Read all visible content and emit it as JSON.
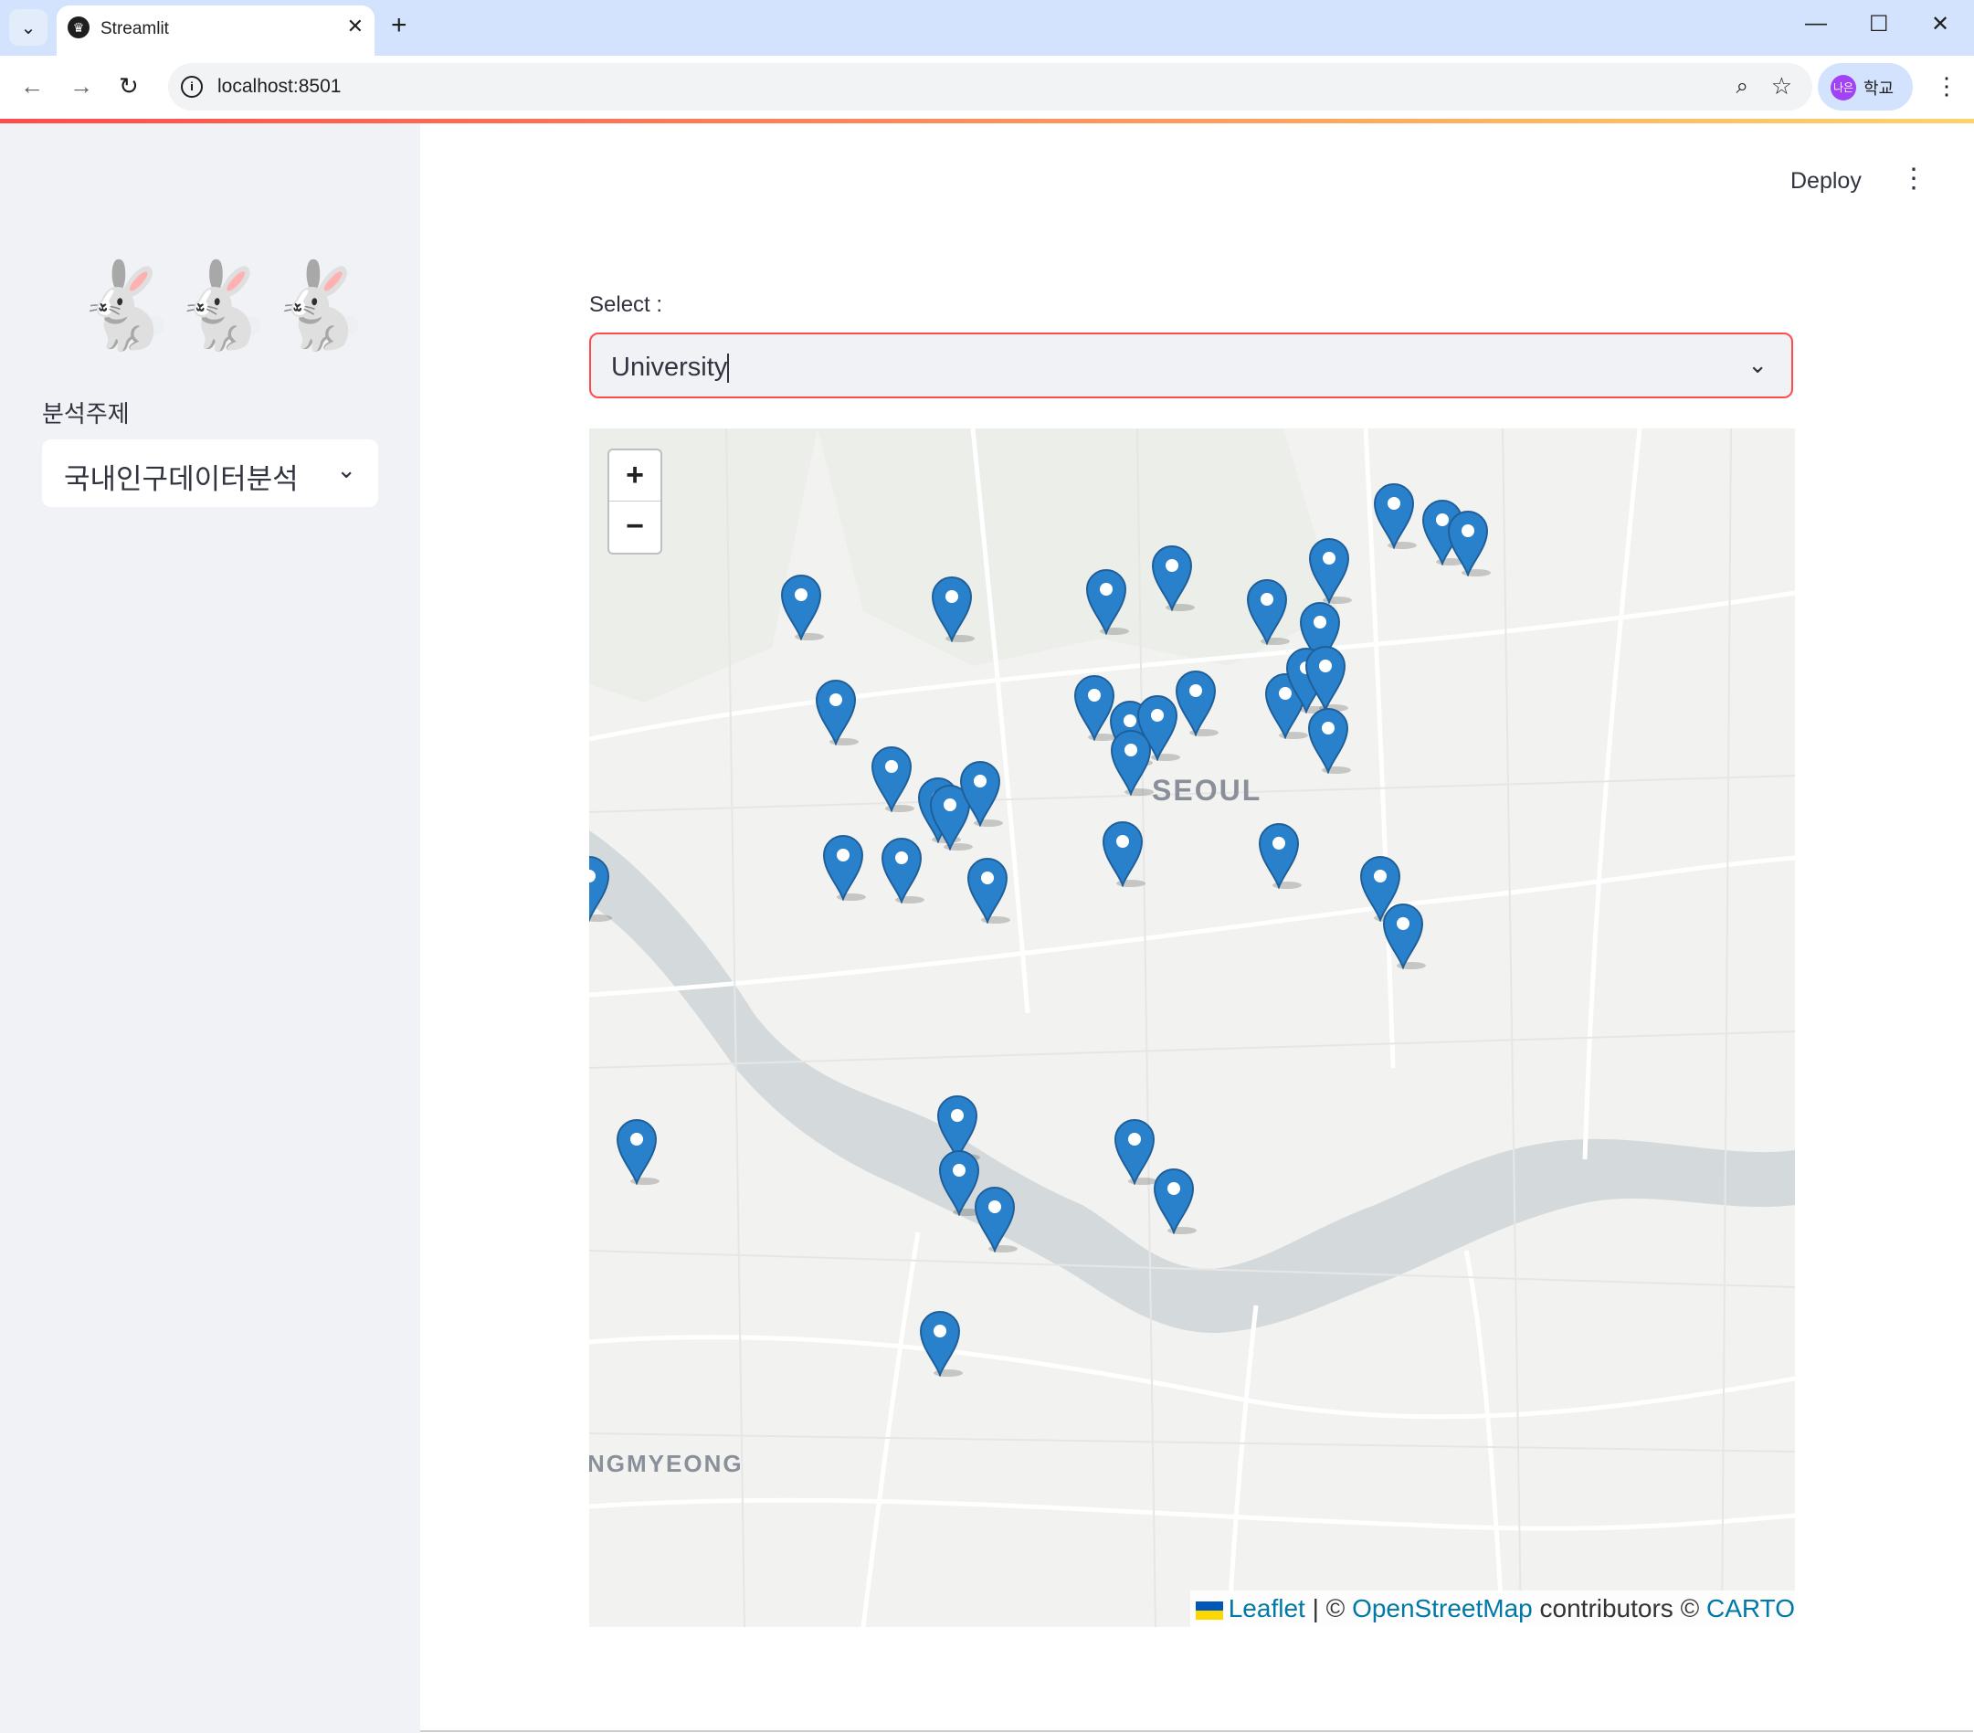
{
  "browser": {
    "tab_title": "Streamlit",
    "url": "localhost:8501",
    "profile_initials": "나은",
    "profile_name": "학교"
  },
  "sidebar": {
    "logo_emoji": "🐇🐇🐇",
    "topic_label": "분석주제",
    "topic_value": "국내인구데이터분석"
  },
  "header": {
    "deploy_label": "Deploy"
  },
  "main": {
    "select_label": "Select :",
    "select_value": "University"
  },
  "map": {
    "zoom_in": "+",
    "zoom_out": "−",
    "city_label": "SEOUL",
    "district_label": "NGMYEONG",
    "attribution": {
      "leaflet": "Leaflet",
      "sep": " | © ",
      "osm": "OpenStreetMap",
      "contrib": " contributors © ",
      "carto": "CARTO"
    },
    "marker_color": "#2a81cb",
    "marker_count": 44
  },
  "colors": {
    "accent": "#ff4b4b",
    "sidebar_bg": "#f0f2f6",
    "water": "#d4dadc"
  }
}
